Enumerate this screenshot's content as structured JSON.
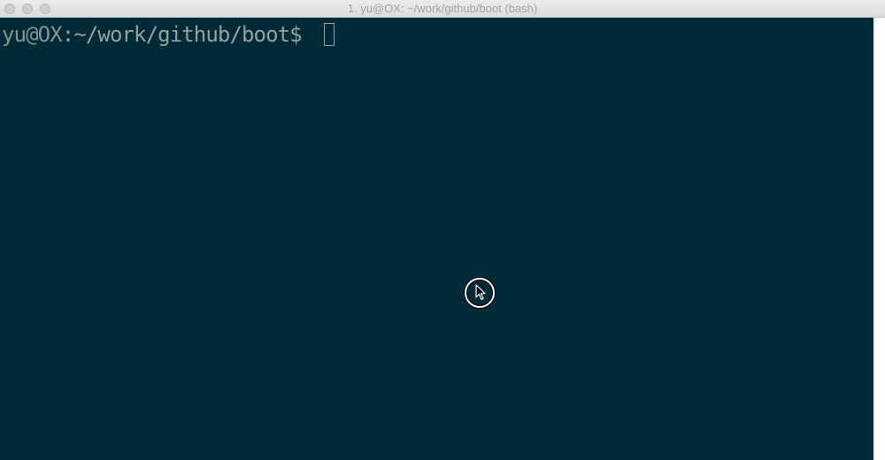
{
  "window": {
    "title": "1. yu@OX: ~/work/github/boot (bash)"
  },
  "terminal": {
    "prompt_user_host": "yu@OX",
    "prompt_path": ":~/work/github/boot$ ",
    "background_color": "#002b36",
    "text_color": "#93a1a1"
  },
  "icons": {
    "close": "close-icon",
    "minimize": "minimize-icon",
    "maximize": "maximize-icon",
    "pointer": "mouse-pointer-icon"
  }
}
